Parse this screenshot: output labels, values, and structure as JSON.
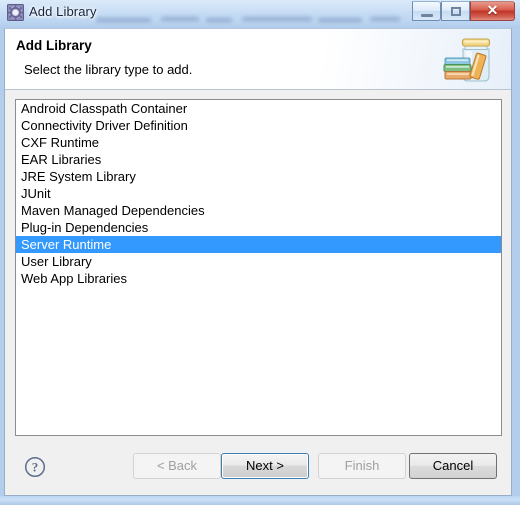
{
  "window": {
    "title": "Add Library",
    "title_icon": "eclipse-gear-icon",
    "controls": {
      "minimize_label": "–",
      "maximize_label": "□",
      "close_label": "✕"
    },
    "colors": {
      "selection": "#3399ff",
      "close_button": "#c2342a",
      "default_button_border": "#3c7fb1",
      "glass": "#bdd6f0"
    }
  },
  "header": {
    "title": "Add Library",
    "description": "Select the library type to add.",
    "icon": "jar-with-books-icon"
  },
  "library_list": {
    "selected_index": 8,
    "items": [
      "Android Classpath Container",
      "Connectivity Driver Definition",
      "CXF Runtime",
      "EAR Libraries",
      "JRE System Library",
      "JUnit",
      "Maven Managed Dependencies",
      "Plug-in Dependencies",
      "Server Runtime",
      "User Library",
      "Web App Libraries"
    ]
  },
  "footer": {
    "help_icon": "help-question-icon",
    "buttons": [
      {
        "label": "< Back",
        "state": "disabled"
      },
      {
        "label": "Next >",
        "state": "default"
      },
      {
        "label": "Finish",
        "state": "disabled"
      },
      {
        "label": "Cancel",
        "state": "enabled"
      }
    ]
  }
}
